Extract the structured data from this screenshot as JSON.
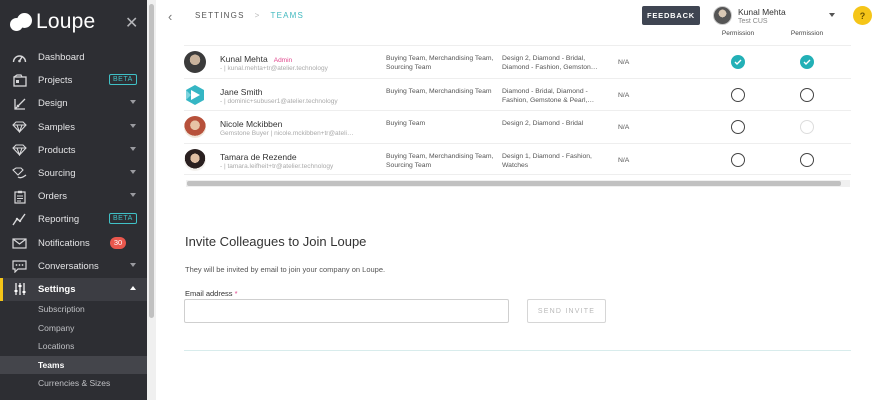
{
  "sidebar": {
    "logo_text": "Loupe",
    "items": [
      {
        "label": "Dashboard",
        "icon": "dashboard-icon"
      },
      {
        "label": "Projects",
        "icon": "projects-icon",
        "badge": "BETA"
      },
      {
        "label": "Design",
        "icon": "design-icon",
        "caret": true
      },
      {
        "label": "Samples",
        "icon": "diamond-icon",
        "caret": true
      },
      {
        "label": "Products",
        "icon": "diamond-icon",
        "caret": true
      },
      {
        "label": "Sourcing",
        "icon": "sourcing-icon",
        "caret": true
      },
      {
        "label": "Orders",
        "icon": "clipboard-icon",
        "caret": true
      },
      {
        "label": "Reporting",
        "icon": "chart-icon",
        "badge": "BETA"
      },
      {
        "label": "Notifications",
        "icon": "envelope-icon",
        "count": "30"
      },
      {
        "label": "Conversations",
        "icon": "chat-icon",
        "caret": true
      },
      {
        "label": "Settings",
        "icon": "sliders-icon",
        "caret": true,
        "active": true
      }
    ],
    "subitems": [
      {
        "label": "Subscription"
      },
      {
        "label": "Company"
      },
      {
        "label": "Locations"
      },
      {
        "label": "Teams",
        "active": true
      },
      {
        "label": "Currencies & Sizes"
      }
    ]
  },
  "header": {
    "breadcrumb": [
      "SETTINGS",
      "TEAMS"
    ],
    "feedback_label": "FEEDBACK",
    "user_name": "Kunal Mehta",
    "user_org": "Test CUS",
    "help_label": "?"
  },
  "table": {
    "columns": [
      "Permission",
      "Permission"
    ],
    "rows": [
      {
        "name": "Kunal Mehta",
        "tag": "Admin",
        "email": "- | kunal.mehta+tr@atelier.technology",
        "teams": "Buying Team, Merchandising Team, Sourcing Team",
        "categories": "Design 2, Diamond - Bridal, Diamond - Fashion, Gemston…",
        "extra": "N/A",
        "perm1": "on",
        "perm2": "on"
      },
      {
        "name": "Jane Smith",
        "tag": "",
        "email": "- | dominic+subuser1@atelier.technology",
        "teams": "Buying Team, Merchandising Team",
        "categories": "Diamond - Bridal, Diamond - Fashion, Gemstone & Pearl,…",
        "extra": "N/A",
        "perm1": "off",
        "perm2": "off"
      },
      {
        "name": "Nicole Mckibben",
        "tag": "",
        "email": "Gemstone Buyer | nicole.mckibben+tr@ateli…",
        "teams": "Buying Team",
        "categories": "Design 2, Diamond - Bridal",
        "extra": "N/A",
        "perm1": "off",
        "perm2": "dim"
      },
      {
        "name": "Tamara de Rezende",
        "tag": "",
        "email": "- | tamara.leifheit+tr@atelier.technology",
        "teams": "Buying Team, Merchandising Team, Sourcing Team",
        "categories": "Design 1, Diamond - Fashion, Watches",
        "extra": "N/A",
        "perm1": "off",
        "perm2": "off"
      }
    ]
  },
  "invite": {
    "title": "Invite Colleagues to Join Loupe",
    "subtitle": "They will be invited by email to join your company on Loupe.",
    "email_label": "Email address",
    "required_mark": "*",
    "email_value": "",
    "send_label": "SEND INVITE"
  },
  "colors": {
    "sidebar_bg": "#2d2e33",
    "accent_teal": "#23b0b6",
    "accent_yellow": "#f5c518",
    "admin_pink": "#e0458c",
    "badge_red": "#e9574d"
  }
}
